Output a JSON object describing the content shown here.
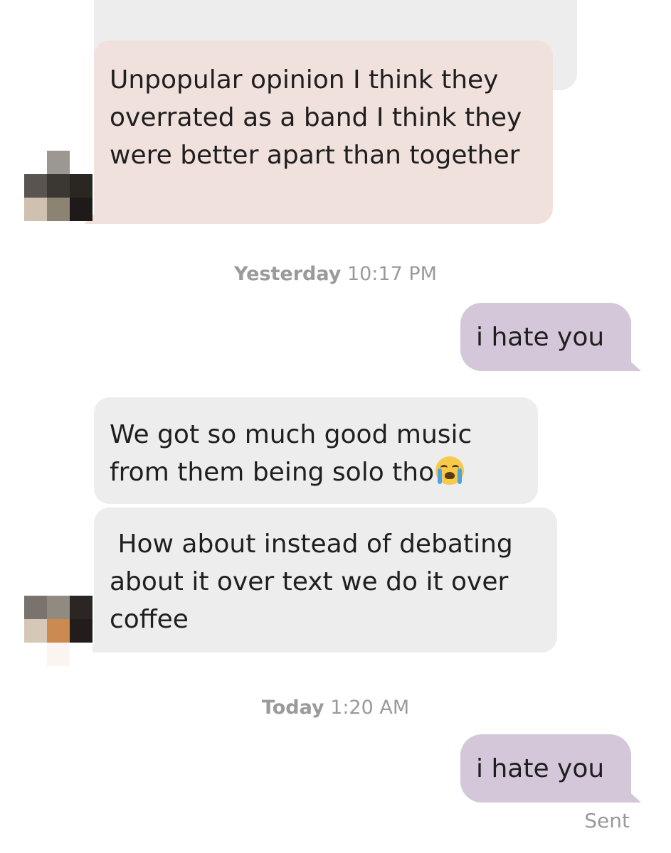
{
  "conversation": {
    "messages": [
      {
        "sender": "them",
        "text": "Unpopular opinion I think they overrated as a band I think they were better apart than together"
      },
      {
        "sender": "me",
        "text": "i hate you"
      },
      {
        "sender": "them",
        "text": "We got so much good music from them being solo tho",
        "emoji": "loudly-crying-face-icon"
      },
      {
        "sender": "them",
        "text": " How about instead of debating about it over text we do it over coffee"
      },
      {
        "sender": "me",
        "text": "i hate you"
      }
    ],
    "timestamps": [
      {
        "day": "Yesterday",
        "time": "10:17 PM"
      },
      {
        "day": "Today",
        "time": "1:20 AM"
      }
    ],
    "status": "Sent"
  },
  "colors": {
    "incoming_bubble": "#ededed",
    "incoming_highlight_bubble": "#f1e1dc",
    "outgoing_bubble": "#d4c7d9",
    "meta_text": "#9a9a9a"
  }
}
